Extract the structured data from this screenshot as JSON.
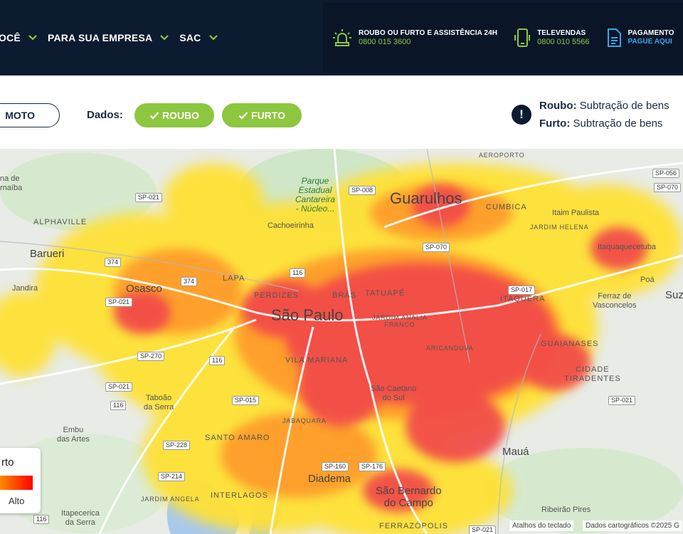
{
  "header": {
    "nav": [
      {
        "label": "OCÊ"
      },
      {
        "label": "PARA SUA EMPRESA"
      },
      {
        "label": "SAC"
      }
    ],
    "contacts": [
      {
        "label": "ROUBO OU FURTO E ASSISTÊNCIA 24H",
        "value": "0800 015 3600",
        "icon": "alarm-bell-icon"
      },
      {
        "label": "TELEVENDAS",
        "value": "0800 010 5566",
        "icon": "smartphone-icon"
      },
      {
        "label": "PAGAMENTO",
        "value": "PAGUE AQUI",
        "icon": "document-icon"
      }
    ]
  },
  "filters": {
    "vehicle_label": "MOTO",
    "dados_label": "Dados:",
    "roubo_label": "ROUBO",
    "furto_label": "FURTO"
  },
  "legend_info": {
    "roubo_term": "Roubo:",
    "roubo_desc": "Subtração de bens",
    "furto_term": "Furto:",
    "furto_desc": "Subtração de bens"
  },
  "map": {
    "places": {
      "sao_paulo": "São Paulo",
      "guarulhos": "Guarulhos",
      "osasco": "Osasco",
      "barueri": "Barueri",
      "diadema": "Diadema",
      "sbc": "São Bernardo\ndo Campo",
      "maua": "Mauá",
      "poa": "Poá",
      "suz": "Suz",
      "alphaville": "ALPHAVILLE",
      "lapa": "LAPA",
      "perdizes": "PERDIZES",
      "bras": "BRÁS",
      "tatuape": "TATUAPÉ",
      "jardim_analia": "JARDIM ANALIA\nFRANCO",
      "aricanduva": "ARICANDUVA",
      "itaquera": "ITAQUERA",
      "guaianases": "GUAIANASES",
      "cidade_tiradentes": "CIDADE\nTIRADENTES",
      "vila_mariana": "VILA MARIANA",
      "santo_amaro": "SANTO AMARO",
      "jabaquara": "JABAQUARA",
      "interlagos": "INTERLAGOS",
      "jardim_angela": "JARDIM ANGELA",
      "ferrazopolis": "FERRAZÓPOLIS",
      "cumbica": "CUMBICA",
      "aeroporto": "AEROPORTO",
      "itaim_paulista": "Itaim Paulista",
      "jardim_helena": "JARDIM HELENA",
      "itaquaquecetuba": "Itaquaquecetuba",
      "ferraz": "Ferraz de\nVasconcelos",
      "cachoeirinha": "Cachoeirinha",
      "parque": "Parque\nEstadual\nCantareira\n- Núcleo...",
      "sao_caetano": "São Caetano\ndo Sul",
      "taboao": "Taboão\nda Serra",
      "embu": "Embu\ndas Artes",
      "itapecerica": "Itapecerica\nda Serra",
      "jandira": "Jandira",
      "ribeirao": "Ribeirão Pires",
      "santana_parnaiba": "na de\nrnaíba"
    },
    "shields": [
      "SP-021",
      "SP-008",
      "374",
      "116",
      "374",
      "SP-021",
      "SP-270",
      "116",
      "SP-021",
      "116",
      "SP-015",
      "SP-228",
      "SP-214",
      "SP-160",
      "SP-176",
      "SP-070",
      "SP-017",
      "SP-021",
      "SP-056",
      "SP-070",
      "116",
      "SP-021"
    ],
    "legend_title": "rto",
    "legend_high": "Alto",
    "attrib_keyboard": "Atalhos do teclado",
    "attrib_data": "Dados cartográficos ©2025 G"
  }
}
